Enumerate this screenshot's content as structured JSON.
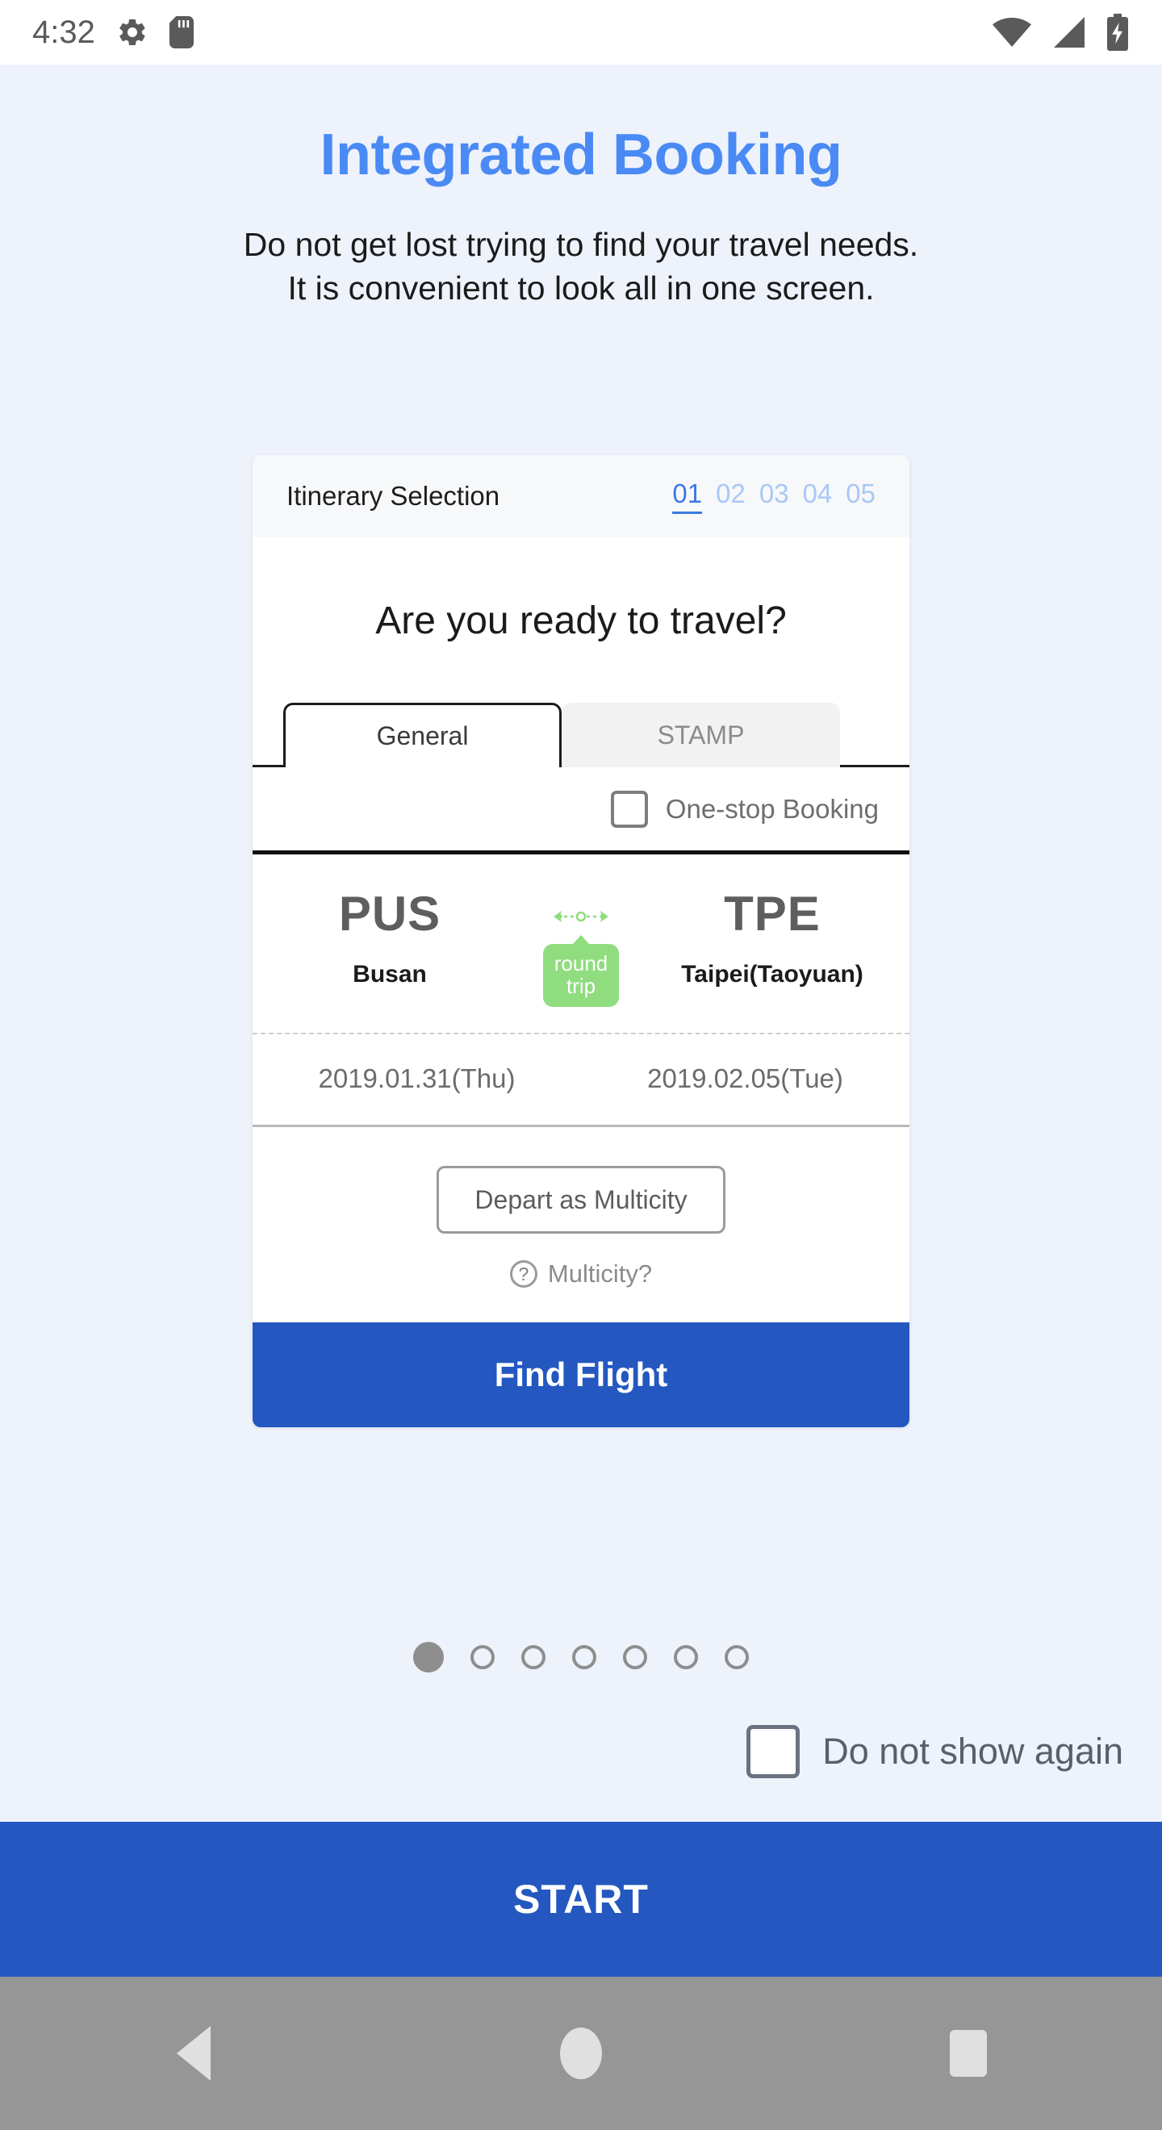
{
  "statusbar": {
    "time": "4:32",
    "icons": [
      "gear-icon",
      "sd-card-icon",
      "wifi-icon",
      "cellular-signal-icon",
      "battery-charging-icon"
    ]
  },
  "header": {
    "title": "Integrated Booking",
    "subtitle_line1": "Do not get lost trying to find your travel needs.",
    "subtitle_line2": "It is convenient to look all in one screen."
  },
  "card": {
    "head_title": "Itinerary Selection",
    "steps": [
      {
        "label": "01",
        "active": true
      },
      {
        "label": "02",
        "active": false
      },
      {
        "label": "03",
        "active": false
      },
      {
        "label": "04",
        "active": false
      },
      {
        "label": "05",
        "active": false
      }
    ],
    "hero": "Are you ready to travel?",
    "tabs": [
      {
        "label": "General",
        "active": true
      },
      {
        "label": "STAMP",
        "active": false
      }
    ],
    "onestop": {
      "label": "One-stop Booking",
      "checked": false
    },
    "route": {
      "origin_code": "PUS",
      "origin_city": "Busan",
      "trip_badge_line1": "round",
      "trip_badge_line2": "trip",
      "destination_code": "TPE",
      "destination_city": "Taipei(Taoyuan)",
      "depart_date": "2019.01.31(Thu)",
      "return_date": "2019.02.05(Tue)"
    },
    "multicity_button": "Depart as Multicity",
    "multicity_help": "Multicity?",
    "find_flight": "Find Flight"
  },
  "pagination": {
    "total": 7,
    "current": 1
  },
  "do_not_show": {
    "label": "Do not show again",
    "checked": false
  },
  "start_button": "START",
  "navbar": {
    "back": "back-button",
    "home": "home-button",
    "recents": "recents-button"
  },
  "colors": {
    "accent_blue": "#4a8af4",
    "primary_blue": "#2458c0",
    "badge_green": "#90dd7f",
    "page_bg": "#eef2fb"
  }
}
